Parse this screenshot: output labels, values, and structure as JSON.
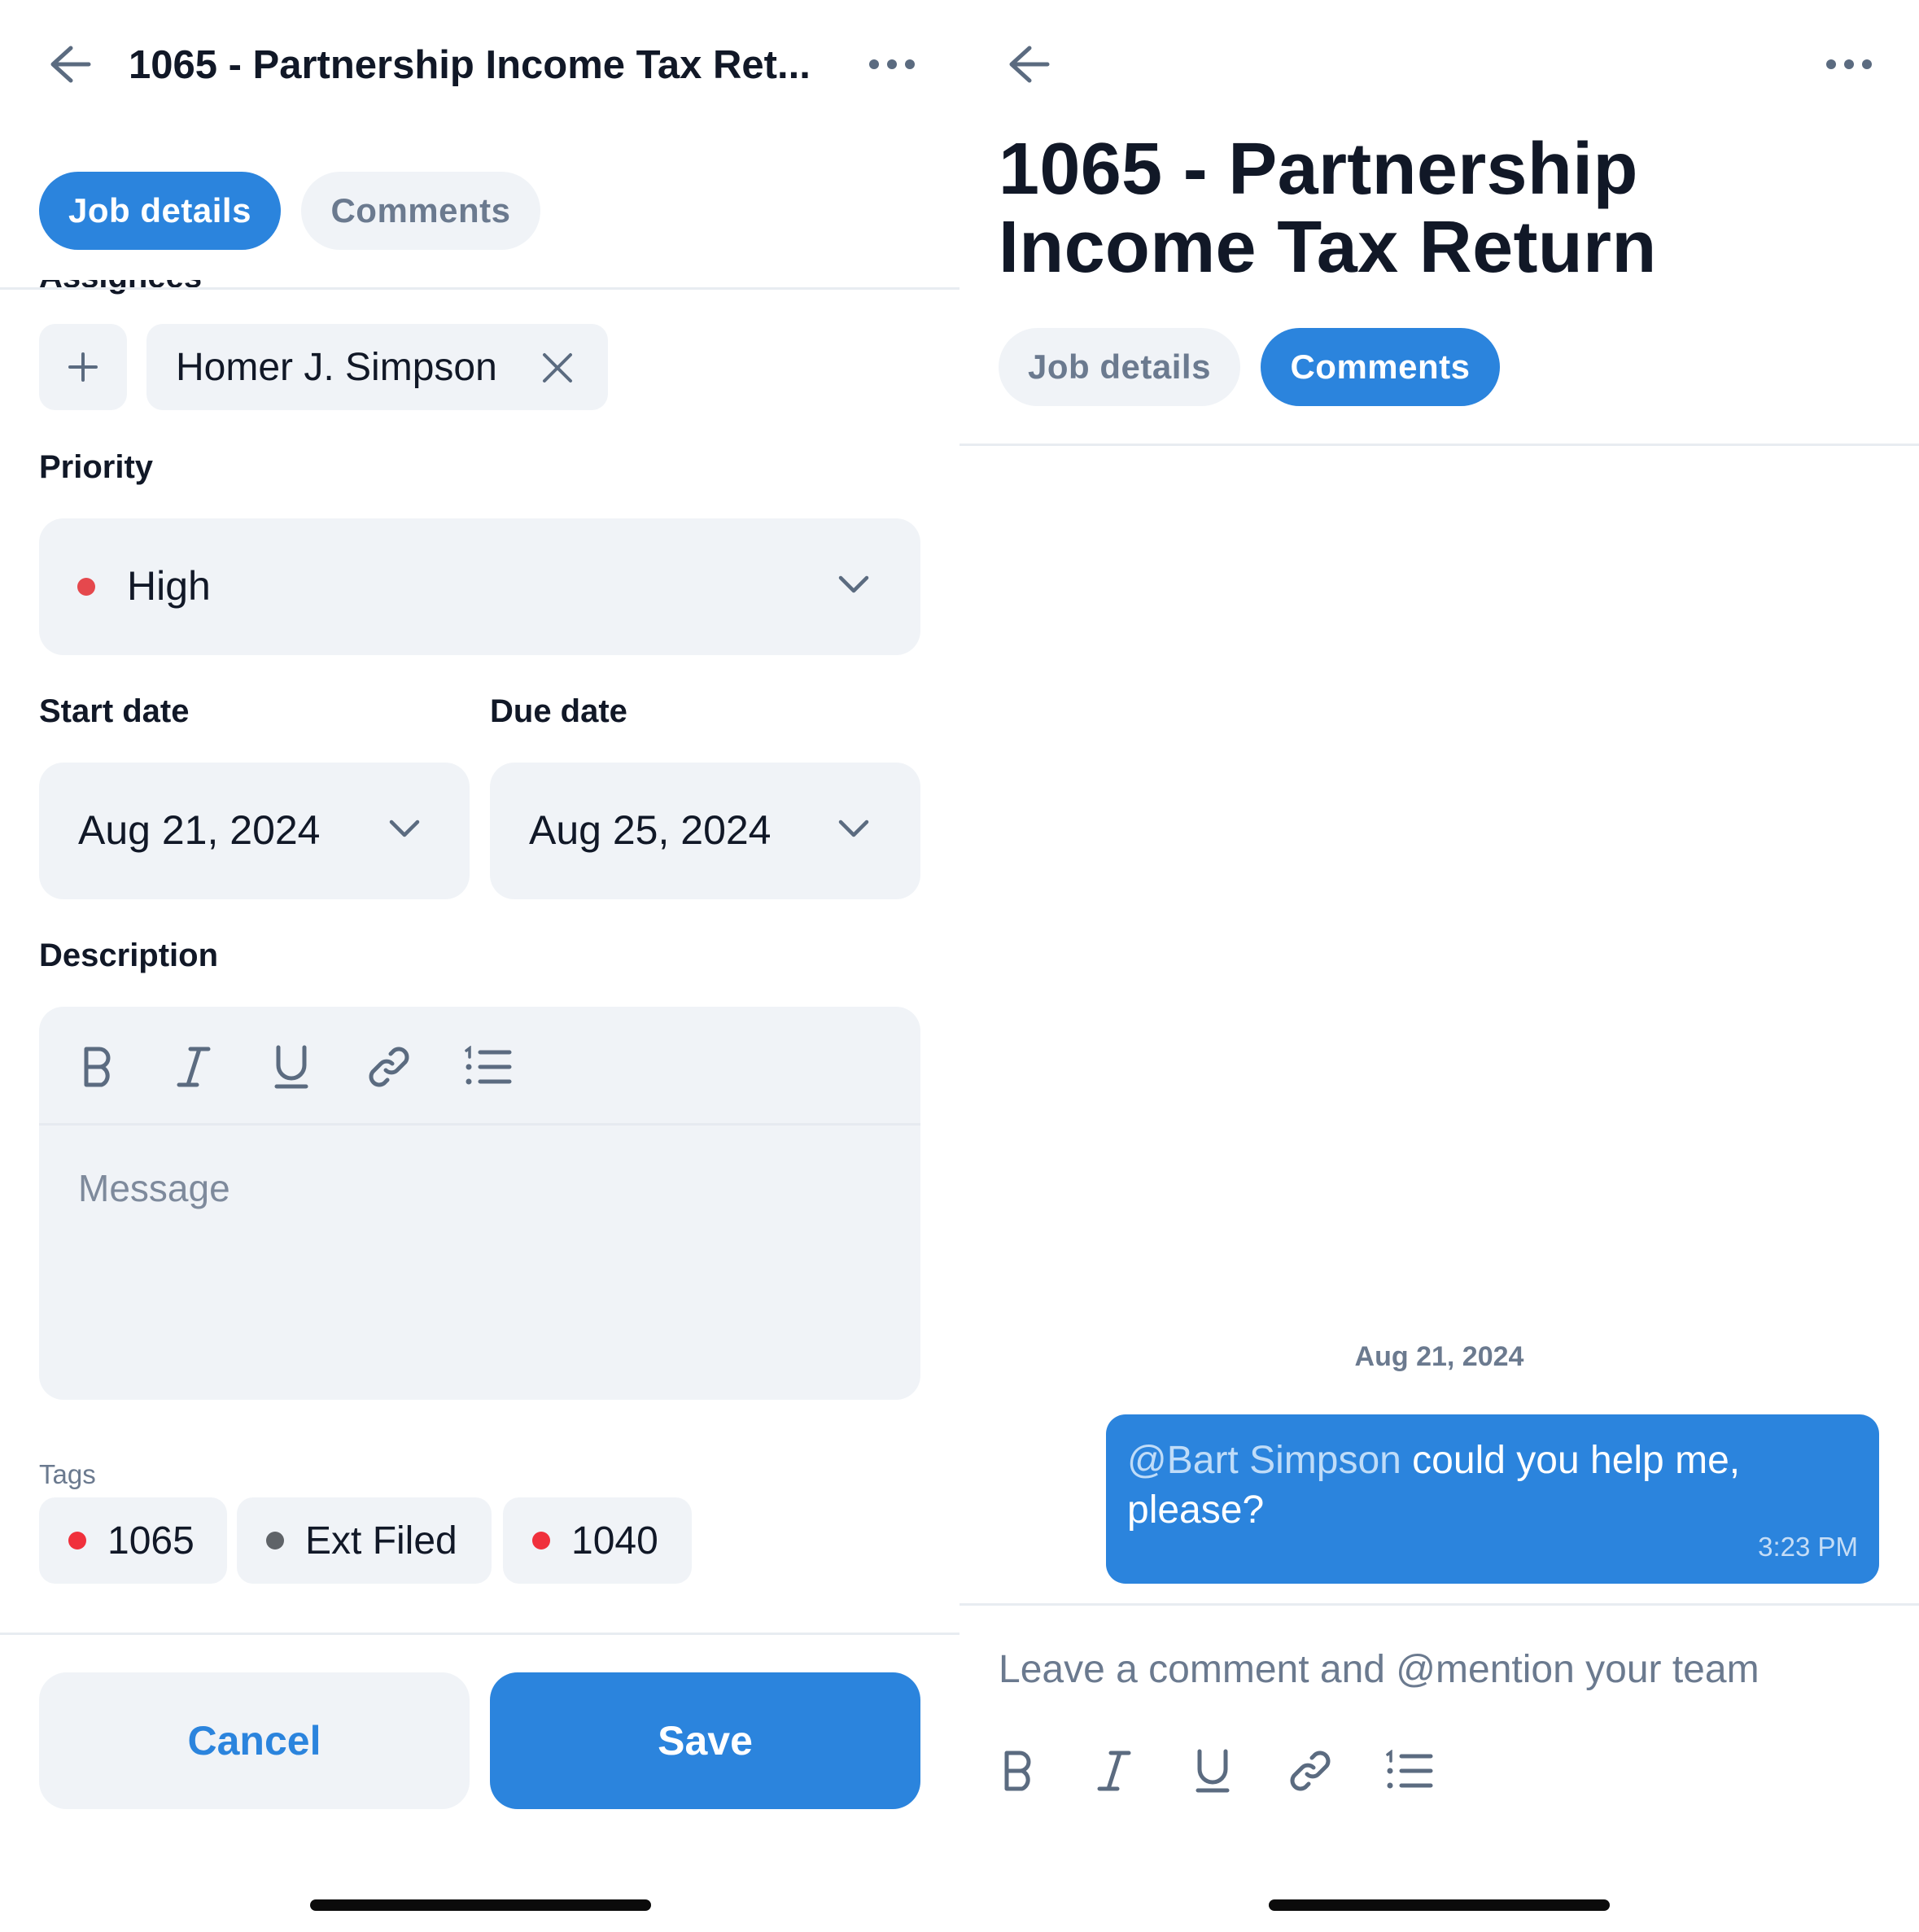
{
  "left": {
    "header": {
      "title": "1065 - Partnership Income Tax Ret..."
    },
    "tabs": [
      {
        "label": "Job details",
        "active": true
      },
      {
        "label": "Comments",
        "active": false
      }
    ],
    "assignees": {
      "label": "Assignees",
      "items": [
        {
          "name": "Homer J. Simpson"
        }
      ]
    },
    "priority": {
      "label": "Priority",
      "value": "High",
      "dot_color": "#E5484D"
    },
    "start_date": {
      "label": "Start date",
      "value": "Aug 21, 2024"
    },
    "due_date": {
      "label": "Due date",
      "value": "Aug 25, 2024"
    },
    "description": {
      "label": "Description",
      "placeholder": "Message",
      "toolbar": [
        "bold-icon",
        "italic-icon",
        "underline-icon",
        "link-icon",
        "numbered-list-icon"
      ]
    },
    "tags": {
      "label": "Tags",
      "items": [
        {
          "name": "1065",
          "color": "#F0303C"
        },
        {
          "name": "Ext Filed",
          "color": "#5F6368"
        },
        {
          "name": "1040",
          "color": "#F0303C"
        }
      ]
    },
    "footer": {
      "cancel_label": "Cancel",
      "save_label": "Save"
    }
  },
  "right": {
    "header": {
      "title": "1065 - Partnership Income Tax Return"
    },
    "tabs": [
      {
        "label": "Job details",
        "active": false
      },
      {
        "label": "Comments",
        "active": true
      }
    ],
    "comments": {
      "date_separator": "Aug 21, 2024",
      "messages": [
        {
          "mention": "@Bart Simpson",
          "text": " could you help me, please?",
          "time": "3:23 PM"
        }
      ]
    },
    "composer": {
      "placeholder": "Leave a comment and @mention your team",
      "toolbar": [
        "bold-icon",
        "italic-icon",
        "underline-icon",
        "link-icon",
        "numbered-list-icon"
      ]
    }
  },
  "colors": {
    "accent": "#2B84DD",
    "field_bg": "#F0F3F7",
    "muted_text": "#6B7A8F",
    "priority_high": "#E5484D"
  }
}
